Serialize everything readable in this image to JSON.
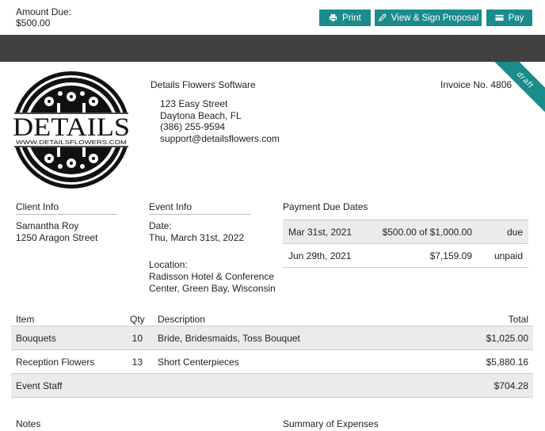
{
  "header": {
    "amount_due_label": "Amount Due:",
    "amount_due_value": "$500.00",
    "buttons": {
      "print": "Print",
      "view_sign": "View & Sign Proposal",
      "pay": "Pay"
    }
  },
  "colors": {
    "accent": "#1b8b8b",
    "dark_bar": "#404040",
    "row_shade": "#ebebeb"
  },
  "badge": "draft",
  "company": {
    "name": "Details Flowers Software",
    "invoice_no": "Invoice No. 4806",
    "address": [
      "123 Easy Street",
      "Daytona Beach, FL",
      "(386) 255-9594",
      "support@detailsflowers.com"
    ],
    "logo_text": "DETAILS",
    "logo_url_text": "WWW.DETAILSFLOWERS.COM"
  },
  "client": {
    "heading": "Client Info",
    "name": "Samantha Roy",
    "street": "1250 Aragon Street"
  },
  "event": {
    "heading": "Event Info",
    "date_label": "Date:",
    "date_value": "Thu, March 31st, 2022",
    "location_label": "Location:",
    "location_line1": "Radisson Hotel & Conference",
    "location_line2": "Center, Green Bay, Wisconsin"
  },
  "payments": {
    "heading": "Payment Due Dates",
    "rows": [
      {
        "date": "Mar 31st, 2021",
        "amount": "$500.00 of $1,000.00",
        "status": "due"
      },
      {
        "date": "Jun 29th, 2021",
        "amount": "$7,159.09",
        "status": "unpaid"
      }
    ]
  },
  "items": {
    "headers": {
      "item": "Item",
      "qty": "Qty",
      "description": "Description",
      "total": "Total"
    },
    "rows": [
      {
        "item": "Bouquets",
        "qty": "10",
        "description": "Bride, Bridesmaids, Toss Bouquet",
        "total": "$1,025.00"
      },
      {
        "item": "Reception Flowers",
        "qty": "13",
        "description": "Short Centerpieces",
        "total": "$5,880.16"
      },
      {
        "item": "Event Staff",
        "qty": "",
        "description": "",
        "total": "$704.28"
      }
    ]
  },
  "footer": {
    "notes": "Notes",
    "summary": "Summary of Expenses"
  }
}
